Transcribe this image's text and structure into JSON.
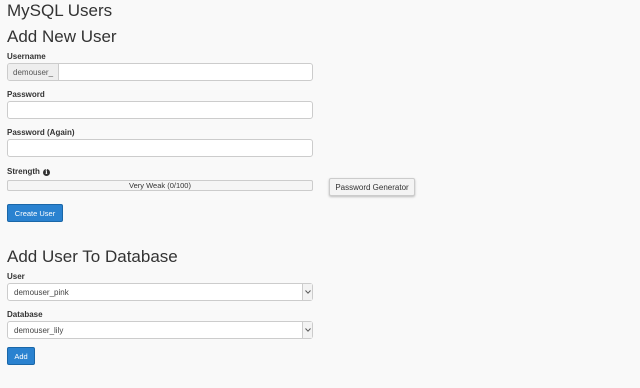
{
  "page": {
    "title": "MySQL Users"
  },
  "add_new_user": {
    "heading": "Add New User",
    "username_label": "Username",
    "username_prefix": "demouser_",
    "username_value": "",
    "password_label": "Password",
    "password_value": "",
    "password_again_label": "Password (Again)",
    "password_again_value": "",
    "strength_label": "Strength",
    "strength_info_icon": "info-circle-icon",
    "strength_text": "Very Weak (0/100)",
    "strength_value": 0,
    "password_generator_label": "Password Generator",
    "create_user_label": "Create User"
  },
  "add_user_to_database": {
    "heading": "Add User To Database",
    "user_label": "User",
    "user_selected": "demouser_pink",
    "database_label": "Database",
    "database_selected": "demouser_lily",
    "dropdown_icon": "chevron-down-icon",
    "add_label": "Add"
  },
  "colors": {
    "primary_button": "#2a82d0",
    "background": "#f9f9f9"
  }
}
